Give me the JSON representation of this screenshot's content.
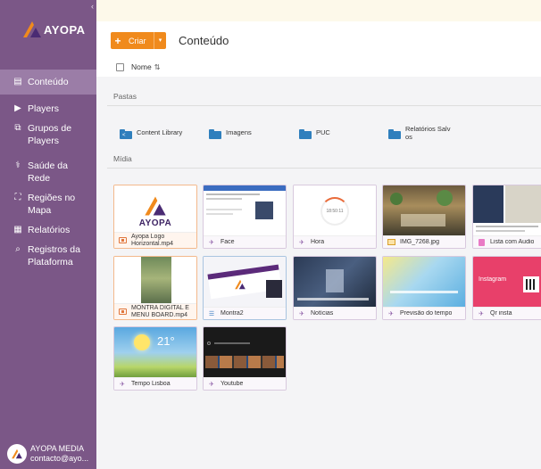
{
  "brand": {
    "name": "AYOPA",
    "accent": "#f08a1c",
    "sidebar_bg": "#7b5787"
  },
  "sidebar": {
    "collapse_glyph": "‹",
    "items": [
      {
        "label": "Conteúdo",
        "icon": "content-icon",
        "active": true
      },
      {
        "label": "Players",
        "icon": "play-icon"
      },
      {
        "label": "Grupos de Players",
        "icon": "player-groups-icon"
      },
      {
        "label": "Saúde da Rede",
        "icon": "stethoscope-icon"
      },
      {
        "label": "Regiões no Mapa",
        "icon": "map-icon"
      },
      {
        "label": "Relatórios",
        "icon": "reports-icon"
      },
      {
        "label": "Registros da Plataforma",
        "icon": "logs-icon"
      }
    ],
    "profile": {
      "name": "AYOPA MEDIA",
      "email": "contacto@ayo..."
    }
  },
  "toolbar": {
    "create_label": "Criar",
    "create_icon": "+",
    "caret": "▾",
    "title": "Conteúdo"
  },
  "list": {
    "name_header": "Nome",
    "sort_icon": "⇅"
  },
  "folders_section": {
    "label": "Pastas",
    "items": [
      {
        "name": "Content Library",
        "shared": true
      },
      {
        "name": "Imagens"
      },
      {
        "name": "PUC"
      },
      {
        "name": "Relatórios Salvos"
      }
    ]
  },
  "media_section": {
    "label": "Mídia",
    "items": [
      {
        "name": "Ayopa Logo Horizontal.mp4",
        "type": "video"
      },
      {
        "name": "Face",
        "type": "app"
      },
      {
        "name": "Hora",
        "type": "app",
        "thumb_text": "18:50:11"
      },
      {
        "name": "IMG_7268.jpg",
        "type": "image"
      },
      {
        "name": "Lista com Audio",
        "type": "playlist"
      },
      {
        "name": "MONTRA DIGITAL E MENU BOARD.mp4",
        "type": "video"
      },
      {
        "name": "Montra2",
        "type": "layout"
      },
      {
        "name": "Notícias",
        "type": "app"
      },
      {
        "name": "Previsão do tempo",
        "type": "app"
      },
      {
        "name": "Qr insta",
        "type": "app",
        "thumb_text": "Instagram"
      },
      {
        "name": "Tempo Lisboa",
        "type": "app",
        "thumb_text": "21°"
      },
      {
        "name": "Youtube",
        "type": "app"
      }
    ]
  }
}
